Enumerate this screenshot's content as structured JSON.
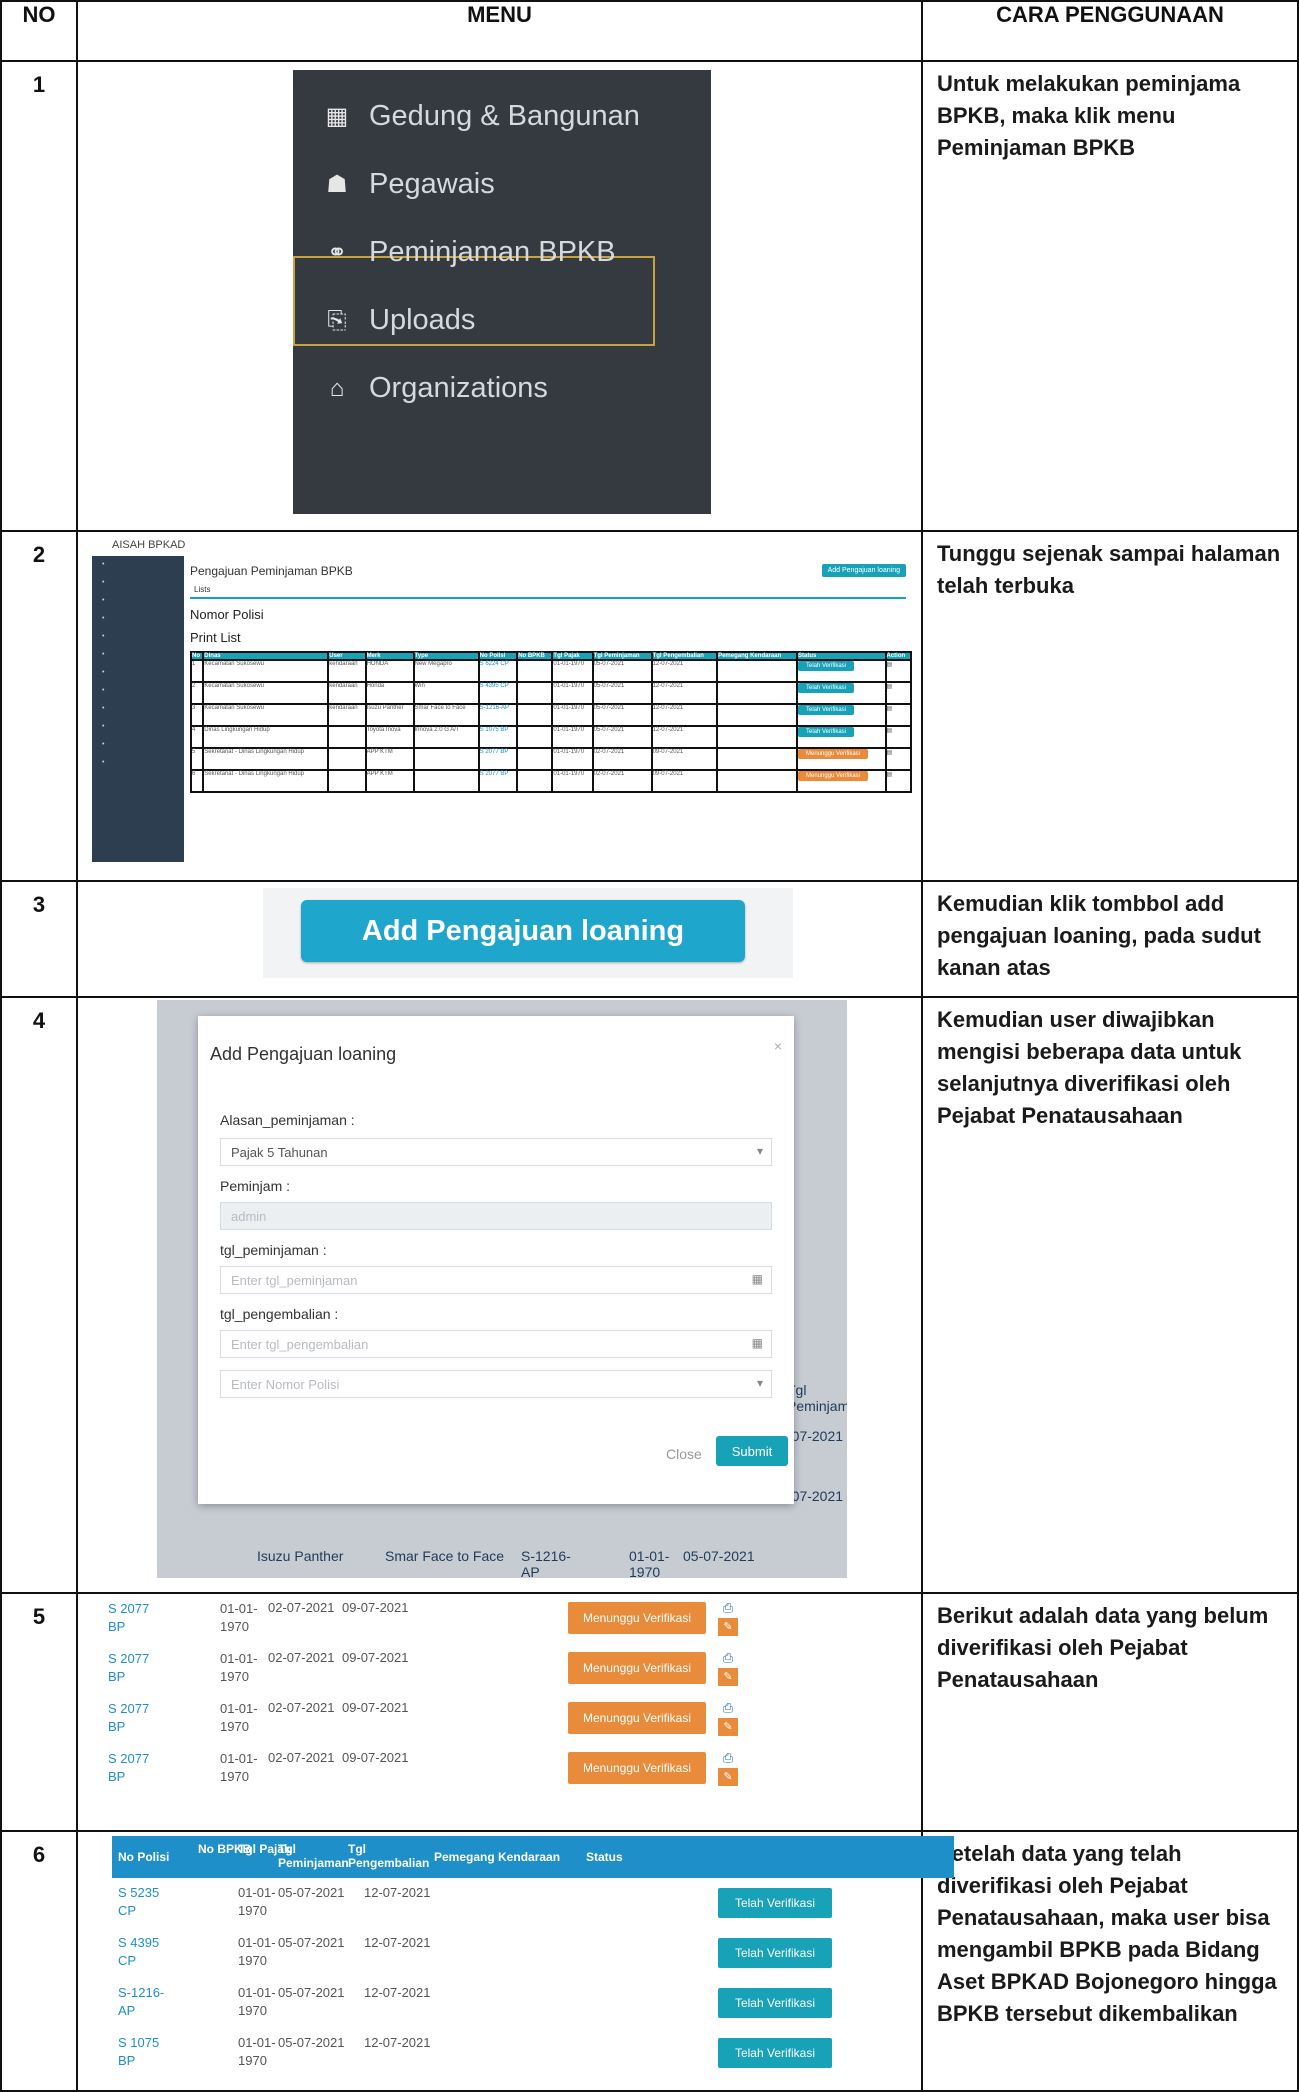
{
  "header": {
    "no": "NO",
    "menu": "MENU",
    "cara": "CARA PENGGUNAAN"
  },
  "rows": [
    {
      "no": "1",
      "cara": "Untuk melakukan peminjama  BPKB, maka klik menu Peminjaman BPKB"
    },
    {
      "no": "2",
      "cara": "Tunggu sejenak sampai halaman telah terbuka"
    },
    {
      "no": "3",
      "cara": "Kemudian klik tombbol add pengajuan loaning, pada sudut kanan atas"
    },
    {
      "no": "4",
      "cara": "Kemudian user diwajibkan mengisi beberapa data untuk selanjutnya diverifikasi oleh Pejabat Penatausahaan"
    },
    {
      "no": "5",
      "cara": "Berikut adalah data yang belum diverifikasi oleh Pejabat Penatausahaan"
    },
    {
      "no": "6",
      "cara": "Setelah data yang telah diverifikasi oleh Pejabat Penatausahaan, maka user bisa mengambil BPKB pada Bidang Aset BPKAD Bojonegoro hingga BPKB tersebut dikembalikan"
    }
  ],
  "menu1": {
    "items": [
      {
        "icon": "building-icon",
        "glyph": "▦",
        "label": "Gedung & Bangunan"
      },
      {
        "icon": "users-icon",
        "glyph": "☗",
        "label": "Pegawais"
      },
      {
        "icon": "link-icon",
        "glyph": "⚭",
        "label": "Peminjaman BPKB"
      },
      {
        "icon": "upload-icon",
        "glyph": "⎘",
        "label": "Uploads"
      },
      {
        "icon": "institution-icon",
        "glyph": "⌂",
        "label": "Organizations"
      }
    ]
  },
  "admin": {
    "brand": "AISAH BPKAD",
    "title": "Pengajuan Peminjaman BPKB",
    "add_button": "Add Pengajuan loaning",
    "tab": "Lists",
    "nomor_polisi": "Nomor Polisi",
    "print_list": "Print List",
    "columns": [
      "No",
      "Dinas",
      "User",
      "Merk",
      "Type",
      "No Polisi",
      "No BPKB",
      "Tgl Pajak",
      "Tgl Peminjaman",
      "Tgl Pengembalian",
      "Pemegang Kendaraan",
      "Status",
      "Action"
    ],
    "rows": [
      [
        "1",
        "Kecamatan Sukosewu",
        "kendaraan",
        "HONDA",
        "New Megapro",
        "S 6224 CP",
        "",
        "01-01-1970",
        "05-07-2021",
        "12-07-2021",
        "",
        "Telah Verifikasi"
      ],
      [
        "2",
        "Kecamatan Sukosewu",
        "kendaraan",
        "Honda",
        "Win",
        "S 4395 CP",
        "",
        "01-01-1970",
        "05-07-2021",
        "12-07-2021",
        "",
        "Telah Verifikasi"
      ],
      [
        "3",
        "Kecamatan Sukosewu",
        "kendaraan",
        "Isuzu Panther",
        "Smar Face to Face",
        "S-1216-AP",
        "",
        "01-01-1970",
        "05-07-2021",
        "12-07-2021",
        "",
        "Telah Verifikasi"
      ],
      [
        "4",
        "Dinas Lingkungan Hidup",
        "",
        "Toyota Inova",
        "Innova 2.0 G A/T",
        "S 1075 BP",
        "",
        "01-01-1970",
        "05-07-2021",
        "12-07-2021",
        "",
        "Telah Verifikasi"
      ],
      [
        "5",
        "Sekretariat - Dinas Lingkungan Hidup",
        "",
        "APP KTM",
        "",
        "S 2077 BP",
        "",
        "01-01-1970",
        "02-07-2021",
        "09-07-2021",
        "",
        "Menunggu Verifikasi"
      ],
      [
        "6",
        "Sekretariat - Dinas Lingkungan Hidup",
        "",
        "APP KTM",
        "",
        "S 2077 BP",
        "",
        "01-01-1970",
        "02-07-2021",
        "09-07-2021",
        "",
        "Menunggu Verifikasi"
      ]
    ]
  },
  "add_button": "Add Pengajuan loaning",
  "modal": {
    "title": "Add Pengajuan loaning",
    "alasan_label": "Alasan_peminjaman :",
    "alasan_value": "Pajak 5 Tahunan",
    "peminjam_label": "Peminjam :",
    "peminjam_value": "admin",
    "tgl_pinjam_label": "tgl_peminjaman :",
    "tgl_pinjam_placeholder": "Enter tgl_peminjaman",
    "tgl_kembali_label": "tgl_pengembalian :",
    "tgl_kembali_placeholder": "Enter tgl_pengembalian",
    "nopol_placeholder": "Enter Nomor Polisi",
    "close": "Close",
    "submit": "Submit",
    "bg_tgl": "Tgl Peminjaman",
    "bg_date": "-07-2021",
    "bg_merk": "Isuzu Panther",
    "bg_type": "Smar Face to Face",
    "bg_nopol": "S-1216-AP",
    "bg_pajak": "01-01-1970",
    "bg_pinjam": "05-07-2021"
  },
  "pending": {
    "rows": [
      {
        "nopol": "S 2077 BP",
        "pajak": "01-01-1970",
        "pinjam": "02-07-2021",
        "kembali": "09-07-2021",
        "status": "Menunggu Verifikasi"
      },
      {
        "nopol": "S 2077 BP",
        "pajak": "01-01-1970",
        "pinjam": "02-07-2021",
        "kembali": "09-07-2021",
        "status": "Menunggu Verifikasi"
      },
      {
        "nopol": "S 2077 BP",
        "pajak": "01-01-1970",
        "pinjam": "02-07-2021",
        "kembali": "09-07-2021",
        "status": "Menunggu Verifikasi"
      },
      {
        "nopol": "S 2077 BP",
        "pajak": "01-01-1970",
        "pinjam": "02-07-2021",
        "kembali": "09-07-2021",
        "status": "Menunggu Verifikasi"
      }
    ]
  },
  "verified": {
    "headers": [
      "No Polisi",
      "No BPKB",
      "Tgl Pajak",
      "Tgl Peminjaman",
      "Tgl Pengembalian",
      "Pemegang Kendaraan",
      "Status"
    ],
    "rows": [
      {
        "nopol": "S 5235 CP",
        "pajak": "01-01-1970",
        "pinjam": "05-07-2021",
        "kembali": "12-07-2021",
        "status": "Telah Verifikasi"
      },
      {
        "nopol": "S 4395 CP",
        "pajak": "01-01-1970",
        "pinjam": "05-07-2021",
        "kembali": "12-07-2021",
        "status": "Telah Verifikasi"
      },
      {
        "nopol": "S-1216-AP",
        "pajak": "01-01-1970",
        "pinjam": "05-07-2021",
        "kembali": "12-07-2021",
        "status": "Telah Verifikasi"
      },
      {
        "nopol": "S 1075 BP",
        "pajak": "01-01-1970",
        "pinjam": "05-07-2021",
        "kembali": "12-07-2021",
        "status": "Telah Verifikasi"
      }
    ]
  },
  "colors": {
    "teal": "#17a2b8",
    "orange": "#e88b3a",
    "dark_menu": "#343a40",
    "highlight": "#c9a13d"
  }
}
